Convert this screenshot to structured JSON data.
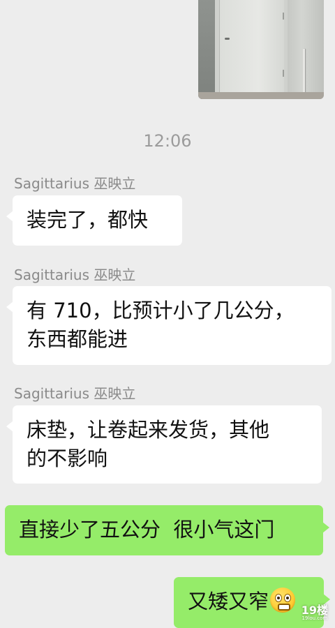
{
  "time_divider": "12:06",
  "messages": [
    {
      "sender": "Sagittarius 巫映立",
      "lines": [
        "装完了，都快"
      ]
    },
    {
      "sender": "Sagittarius 巫映立",
      "lines": [
        "有 710，比预计小了几公分，",
        "东西都能进"
      ]
    },
    {
      "sender": "Sagittarius 巫映立",
      "lines": [
        "床垫，让卷起来发货，其他",
        "的不影响"
      ]
    }
  ],
  "replies": [
    {
      "text": "直接少了五公分  很小气这门"
    },
    {
      "text": "又矮又窄",
      "emoji": "grimacing-face-icon"
    }
  ],
  "watermark": {
    "brand": "19楼",
    "domain": "19lou.com"
  },
  "colors": {
    "background": "#ededed",
    "incoming_bubble": "#ffffff",
    "outgoing_bubble": "#95ec69",
    "sender_name": "#8a8a8a",
    "timestamp": "#9b9b9b"
  }
}
